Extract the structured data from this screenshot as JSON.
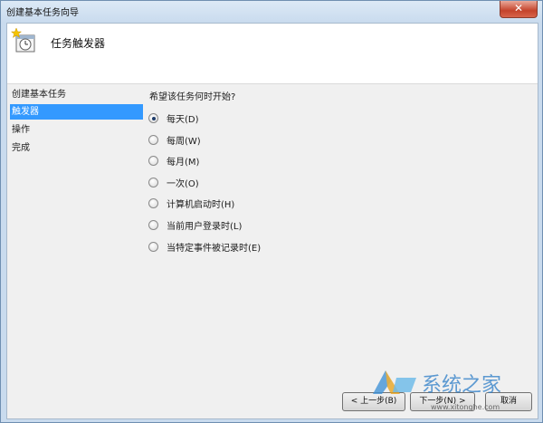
{
  "window": {
    "title": "创建基本任务向导",
    "close_glyph": "✕"
  },
  "header": {
    "title": "任务触发器",
    "icon": "scheduled-task-clock-icon"
  },
  "sidebar": {
    "items": [
      {
        "label": "创建基本任务",
        "active": false
      },
      {
        "label": "触发器",
        "active": true
      },
      {
        "label": "操作",
        "active": false
      },
      {
        "label": "完成",
        "active": false
      }
    ]
  },
  "main": {
    "prompt": "希望该任务何时开始?",
    "options": [
      {
        "label": "每天(D)",
        "checked": true
      },
      {
        "label": "每周(W)",
        "checked": false
      },
      {
        "label": "每月(M)",
        "checked": false
      },
      {
        "label": "一次(O)",
        "checked": false
      },
      {
        "label": "计算机启动时(H)",
        "checked": false
      },
      {
        "label": "当前用户登录时(L)",
        "checked": false
      },
      {
        "label": "当特定事件被记录时(E)",
        "checked": false
      }
    ]
  },
  "footer": {
    "back_label": "< 上一步(B)",
    "next_label": "下一步(N) >",
    "cancel_label": "取消"
  },
  "watermark": {
    "text": "系统之家",
    "url": "www.xitonghe.com"
  },
  "colors": {
    "selection": "#3399ff",
    "title_bar": "#c9dbee",
    "close_button": "#c4432b"
  }
}
